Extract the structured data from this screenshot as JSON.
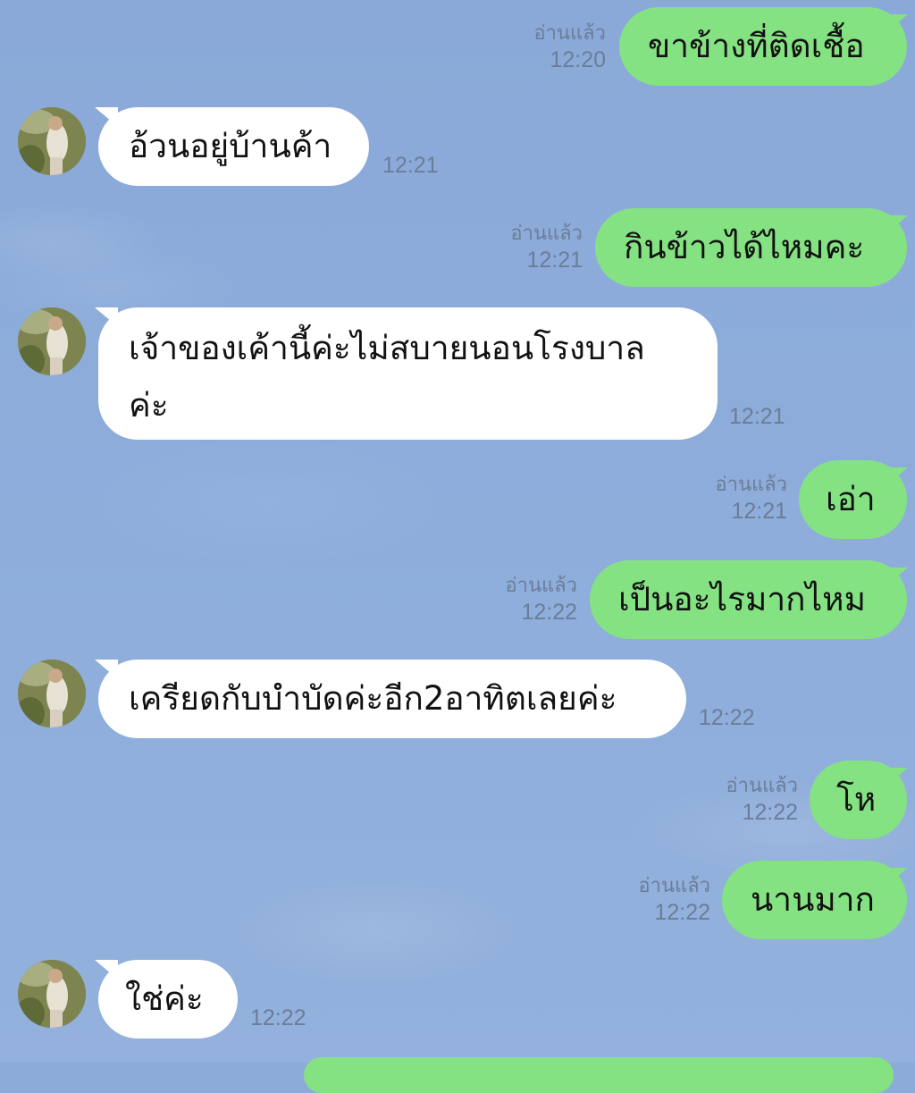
{
  "messages": [
    {
      "side": "out",
      "text": "ขาข้างที่ติดเชื้อ",
      "read": "อ่านแล้ว",
      "time": "12:20"
    },
    {
      "side": "in",
      "text": "อ้วนอยู่บ้านค้า",
      "time": "12:21"
    },
    {
      "side": "out",
      "text": "กินข้าวได้ไหมคะ",
      "read": "อ่านแล้ว",
      "time": "12:21"
    },
    {
      "side": "in",
      "text_line1": "เจ้าของเค้านี้ค่ะไม่สบายนอนโรงบาล",
      "text_line2": "ค่ะ",
      "time": "12:21"
    },
    {
      "side": "out",
      "text": "เอ่า",
      "read": "อ่านแล้ว",
      "time": "12:21"
    },
    {
      "side": "out",
      "text": "เป็นอะไรมากไหม",
      "read": "อ่านแล้ว",
      "time": "12:22"
    },
    {
      "side": "in",
      "text": "เครียดกับบำบัดค่ะอีก2อาทิตเลยค่ะ",
      "time": "12:22"
    },
    {
      "side": "out",
      "text": "โห",
      "read": "อ่านแล้ว",
      "time": "12:22"
    },
    {
      "side": "out",
      "text": "นานมาก",
      "read": "อ่านแล้ว",
      "time": "12:22"
    },
    {
      "side": "in",
      "text": "ใช่ค่ะ",
      "time": "12:22"
    }
  ],
  "colors": {
    "background": "#8cabd9",
    "outgoing_bubble": "#85e283",
    "incoming_bubble": "#ffffff",
    "meta_text": "#6b7d99"
  },
  "icons": {
    "avatar": "contact-avatar-photo"
  }
}
